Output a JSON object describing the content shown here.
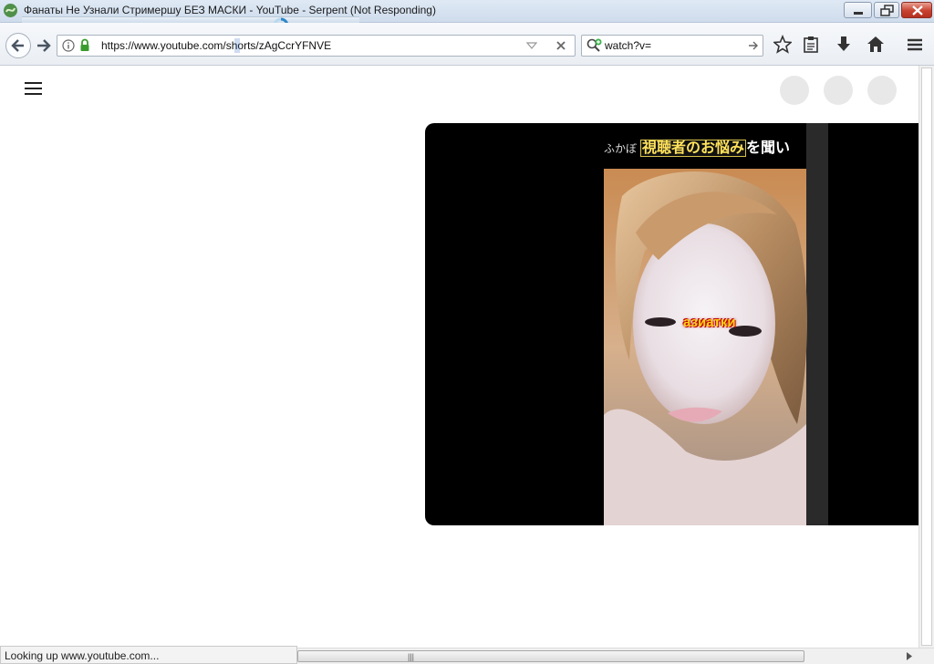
{
  "window": {
    "title": "Фанаты Не Узнали Стримершу БЕЗ МАСКИ - YouTube - Serpent (Not Responding)"
  },
  "navbar": {
    "url": "https://www.youtube.com/shorts/zAgCcrYFNVE",
    "search_value": "watch?v="
  },
  "video": {
    "caption_small": "ふかぼ",
    "caption_boxed": "視聴者のお悩み",
    "caption_rest": "を聞い",
    "overlay_text": "азиатки"
  },
  "status": {
    "text": "Looking up www.youtube.com..."
  },
  "colors": {
    "close_button": "#c8412f",
    "overlay_text": "#ffd21a",
    "page_background": "#ffffff"
  }
}
